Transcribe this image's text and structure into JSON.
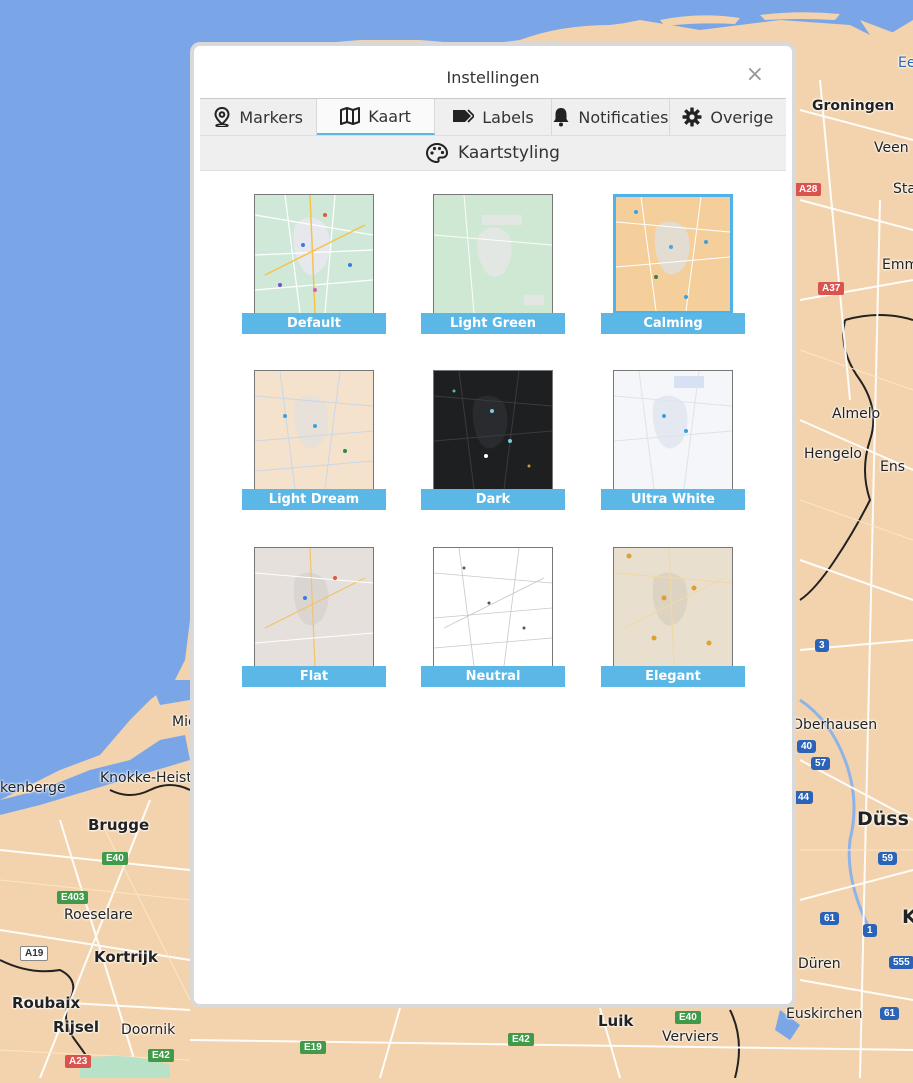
{
  "map": {
    "places": [
      {
        "name": "Groningen",
        "cls": "bold"
      },
      {
        "name": "Veen"
      },
      {
        "name": "Sta"
      },
      {
        "name": "Emm"
      },
      {
        "name": "Almelo"
      },
      {
        "name": "Hengelo"
      },
      {
        "name": "Ens"
      },
      {
        "name": "Oberhausen"
      },
      {
        "name": "Düss",
        "cls": "big"
      },
      {
        "name": "Düren"
      },
      {
        "name": "Euskirchen"
      },
      {
        "name": "K"
      },
      {
        "name": "Mid"
      },
      {
        "name": "kenberge"
      },
      {
        "name": "Knokke-Heist"
      },
      {
        "name": "Brugge",
        "cls": "bold"
      },
      {
        "name": "Roeselare"
      },
      {
        "name": "Kortrijk",
        "cls": "bold"
      },
      {
        "name": "Roubaix",
        "cls": "bold"
      },
      {
        "name": "Rijsel",
        "cls": "bold"
      },
      {
        "name": "Doornik"
      },
      {
        "name": "Luik",
        "cls": "bold"
      },
      {
        "name": "Verviers"
      },
      {
        "name": "Ee"
      }
    ],
    "shields": [
      {
        "label": "A28",
        "color": "red"
      },
      {
        "label": "A37",
        "color": "red"
      },
      {
        "label": "E40",
        "color": "green"
      },
      {
        "label": "E403",
        "color": "green"
      },
      {
        "label": "A19",
        "color": "white"
      },
      {
        "label": "E42",
        "color": "green"
      },
      {
        "label": "A23",
        "color": "red"
      },
      {
        "label": "E19",
        "color": "green"
      },
      {
        "label": "E42",
        "color": "green"
      },
      {
        "label": "E40",
        "color": "green"
      },
      {
        "label": "3",
        "color": "blue"
      },
      {
        "label": "40",
        "color": "blue"
      },
      {
        "label": "57",
        "color": "blue"
      },
      {
        "label": "44",
        "color": "blue"
      },
      {
        "label": "59",
        "color": "blue"
      },
      {
        "label": "61",
        "color": "blue"
      },
      {
        "label": "1",
        "color": "blue"
      },
      {
        "label": "555",
        "color": "blue"
      },
      {
        "label": "61",
        "color": "blue"
      }
    ]
  },
  "dialog": {
    "title": "Instellingen",
    "close_icon": "×",
    "tabs": [
      {
        "label": "Markers",
        "icon": "map-pin-icon"
      },
      {
        "label": "Kaart",
        "icon": "map-icon",
        "active": true
      },
      {
        "label": "Labels",
        "icon": "tag-icon"
      },
      {
        "label": "Notificaties",
        "icon": "bell-icon"
      },
      {
        "label": "Overige",
        "icon": "gear-icon"
      }
    ],
    "subtab": {
      "label": "Kaartstyling",
      "icon": "palette-icon"
    },
    "styles": [
      {
        "label": "Default",
        "theme": "default"
      },
      {
        "label": "Light Green",
        "theme": "lightgreen"
      },
      {
        "label": "Calming",
        "theme": "calming",
        "selected": true
      },
      {
        "label": "Light Dream",
        "theme": "lightdream"
      },
      {
        "label": "Dark",
        "theme": "dark"
      },
      {
        "label": "Ultra White",
        "theme": "ultrawhite"
      },
      {
        "label": "Flat",
        "theme": "flat"
      },
      {
        "label": "Neutral",
        "theme": "neutral"
      },
      {
        "label": "Elegant",
        "theme": "elegant"
      }
    ]
  },
  "colors": {
    "land": "#f2d3ad",
    "water": "#7aa6e8",
    "accent": "#5bb8e6"
  }
}
